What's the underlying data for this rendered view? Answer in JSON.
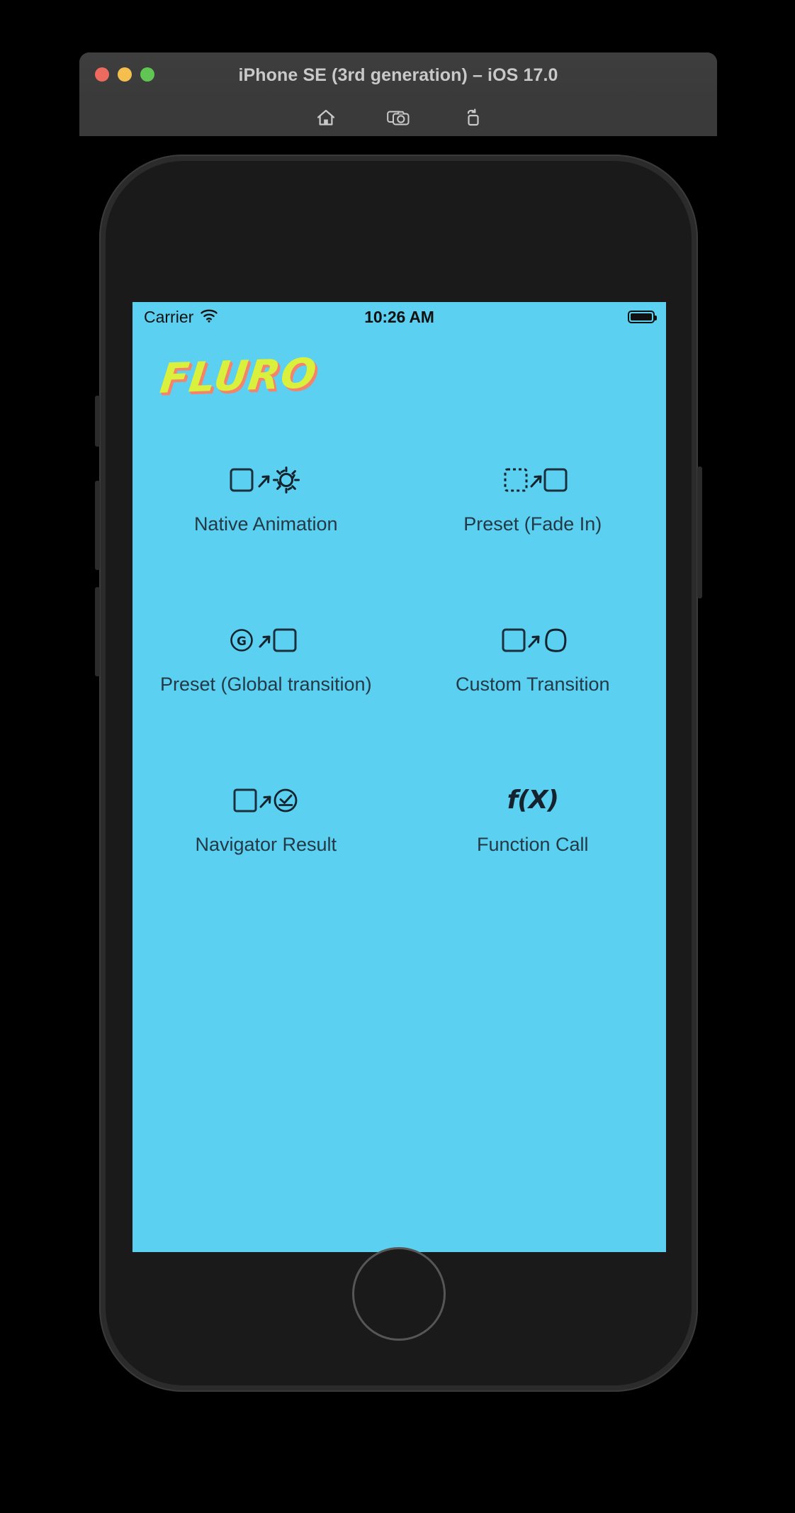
{
  "window": {
    "title": "iPhone SE (3rd generation) – iOS 17.0",
    "traffic_lights": [
      {
        "name": "close",
        "color": "#ed6a5f"
      },
      {
        "name": "minimize",
        "color": "#f5bf4f"
      },
      {
        "name": "zoom",
        "color": "#61c554"
      }
    ],
    "toolbar": [
      {
        "name": "home-icon",
        "label": "Home"
      },
      {
        "name": "screenshot-icon",
        "label": "Screenshot"
      },
      {
        "name": "share-icon",
        "label": "Share"
      }
    ]
  },
  "status_bar": {
    "carrier": "Carrier",
    "wifi_icon": "wifi-icon",
    "time": "10:26 AM",
    "battery_icon": "battery-full-icon"
  },
  "app": {
    "logo_text": "FLURO",
    "logo_color": "#d9f03c",
    "logo_shadow_color": "#f4836b",
    "background_color": "#5bd0f0",
    "label_color": "#233a46",
    "items": [
      {
        "label": "Native Animation",
        "icon": "square-to-gear-icon"
      },
      {
        "label": "Preset (Fade In)",
        "icon": "dashed-square-to-square-icon"
      },
      {
        "label": "Preset (Global transition)",
        "icon": "g-circle-to-square-icon"
      },
      {
        "label": "Custom Transition",
        "icon": "square-to-blob-icon"
      },
      {
        "label": "Navigator Result",
        "icon": "square-to-check-circle-icon"
      },
      {
        "label": "Function Call",
        "icon": "function-fx-icon",
        "glyph": "f(X)"
      }
    ]
  }
}
